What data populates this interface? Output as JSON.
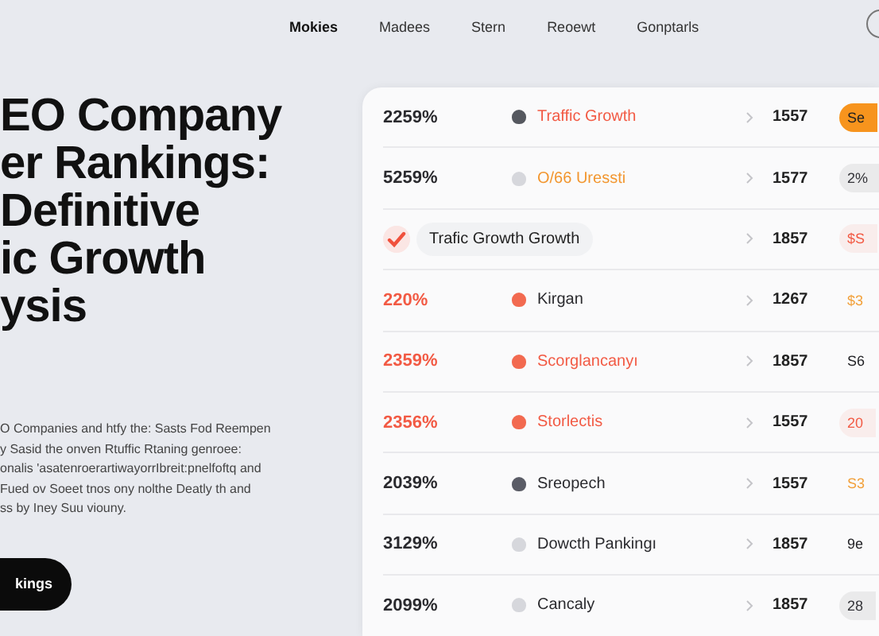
{
  "nav": {
    "items": [
      {
        "label": "Mokies",
        "selected": true
      },
      {
        "label": "Madees",
        "selected": false
      },
      {
        "label": "Stern",
        "selected": false
      },
      {
        "label": "Reoewt",
        "selected": false
      },
      {
        "label": "Gonptarls",
        "selected": false
      }
    ]
  },
  "hero": {
    "heading": "EO Company\ner Rankings:\nDefinitive\nic Growth\nysis",
    "text": "O Companies and htfy the: Sasts Fod Reempen\ny Sasid the onven Rtuffic Rtaning genroee:\nonalis 'asatenroerartiwayorrIbreit:pnelfoftq and\nFued ov Soeet tnos ony nolthe Deatly th and\nss by Iney Suu viouny.",
    "button": "kings"
  },
  "rows": [
    {
      "kind": "metric",
      "percent": {
        "text": "2259%",
        "color": "#2a2a2e"
      },
      "color": "#55585f",
      "name": {
        "text": "Traffic Growth",
        "color": "#f25a44"
      },
      "number": "1557",
      "badge": {
        "text": "Se",
        "kind": "filled",
        "color": "#f7941d"
      }
    },
    {
      "kind": "metric",
      "percent": {
        "text": "5259%",
        "color": "#2a2a2e"
      },
      "color": "#d6d7dc",
      "name": {
        "text": "O/66 Uressti",
        "color": "#f2962f"
      },
      "number": "1577",
      "badge": {
        "text": "2%",
        "kind": "soft",
        "color": "#333338"
      }
    },
    {
      "kind": "checked",
      "label": "Trafic Growth Growth",
      "number": "1857",
      "badge": {
        "text": "$S",
        "kind": "soft",
        "color": "#f25a44"
      }
    },
    {
      "kind": "metric",
      "percent": {
        "text": "220%",
        "color": "#f25a44"
      },
      "color": "#f26a50",
      "name": {
        "text": "Kirgan",
        "color": "#2a2a2e"
      },
      "number": "1267",
      "badge": {
        "text": "$3",
        "kind": "plain",
        "color": "#f2a03a"
      }
    },
    {
      "kind": "metric",
      "percent": {
        "text": "2359%",
        "color": "#f25a44"
      },
      "color": "#f26a50",
      "name": {
        "text": "Scorglancanyı",
        "color": "#f25a44"
      },
      "number": "1857",
      "badge": {
        "text": "S6",
        "kind": "plain",
        "color": "#222226"
      }
    },
    {
      "kind": "metric",
      "percent": {
        "text": "2356%",
        "color": "#f25a44"
      },
      "color": "#f26a50",
      "name": {
        "text": "Storlectis",
        "color": "#f25a44"
      },
      "number": "1557",
      "badge": {
        "text": "20",
        "kind": "soft",
        "color": "#f25a44"
      }
    },
    {
      "kind": "metric",
      "percent": {
        "text": "2039%",
        "color": "#2a2a2e"
      },
      "color": "#5a5c66",
      "name": {
        "text": "Sreopech",
        "color": "#2a2a2e"
      },
      "number": "1557",
      "badge": {
        "text": "S3",
        "kind": "plain",
        "color": "#f2a03a"
      }
    },
    {
      "kind": "metric",
      "percent": {
        "text": "3129%",
        "color": "#2a2a2e"
      },
      "color": "#d6d7dc",
      "name": {
        "text": "Dowcth Pankingı",
        "color": "#2a2a2e"
      },
      "number": "1857",
      "badge": {
        "text": "9e",
        "kind": "plain",
        "color": "#222226"
      }
    },
    {
      "kind": "metric",
      "percent": {
        "text": "2099%",
        "color": "#2a2a2e"
      },
      "color": "#d6d7dc",
      "name": {
        "text": "Cancaly",
        "color": "#2a2a2e"
      },
      "number": "1857",
      "badge": {
        "text": "28",
        "kind": "soft",
        "color": "#333338"
      }
    }
  ]
}
